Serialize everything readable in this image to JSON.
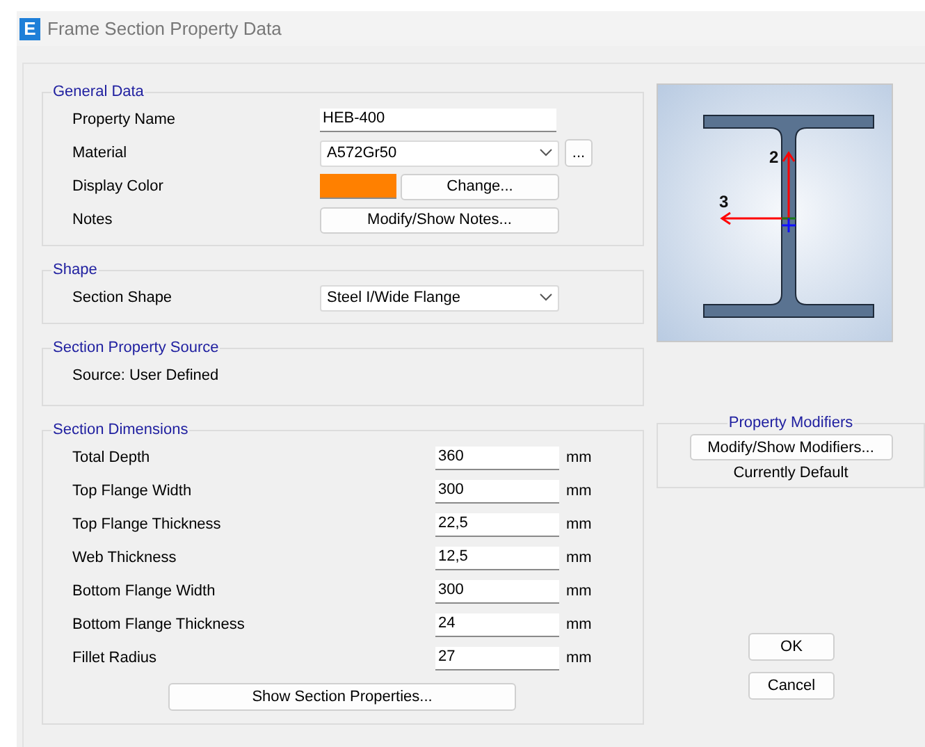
{
  "window": {
    "icon_letter": "E",
    "title": "Frame Section Property Data"
  },
  "general_data": {
    "title": "General Data",
    "rows": [
      {
        "kind": "text",
        "label": "Property Name",
        "value": "HEB-400"
      },
      {
        "kind": "dropdown",
        "label": "Material",
        "value": "A572Gr50",
        "button": "..."
      },
      {
        "kind": "color",
        "label": "Display Color",
        "color": "#ff8000",
        "button": "Change..."
      },
      {
        "kind": "button",
        "label": "Notes",
        "button": "Modify/Show Notes..."
      }
    ]
  },
  "shape": {
    "title": "Shape",
    "rows": [
      {
        "kind": "dropdown",
        "label": "Section Shape",
        "value": "Steel I/Wide Flange"
      }
    ]
  },
  "property_source": {
    "title": "Section Property Source",
    "text": "Source:  User Defined"
  },
  "section_dimensions": {
    "title": "Section Dimensions",
    "rows": [
      {
        "label": "Total Depth",
        "value": "360",
        "unit": "mm"
      },
      {
        "label": "Top Flange Width",
        "value": "300",
        "unit": "mm"
      },
      {
        "label": "Top Flange Thickness",
        "value": "22,5",
        "unit": "mm"
      },
      {
        "label": "Web Thickness",
        "value": "12,5",
        "unit": "mm"
      },
      {
        "label": "Bottom Flange Width",
        "value": "300",
        "unit": "mm"
      },
      {
        "label": "Bottom Flange Thickness",
        "value": "24",
        "unit": "mm"
      },
      {
        "label": "Fillet Radius",
        "value": "27",
        "unit": "mm"
      }
    ],
    "button": "Show Section Properties..."
  },
  "preview": {
    "axis_labels": [
      "2",
      "3"
    ]
  },
  "property_modifiers": {
    "title": "Property Modifiers",
    "button": "Modify/Show Modifiers...",
    "status": "Currently Default"
  },
  "buttons": [
    "OK",
    "Cancel"
  ]
}
